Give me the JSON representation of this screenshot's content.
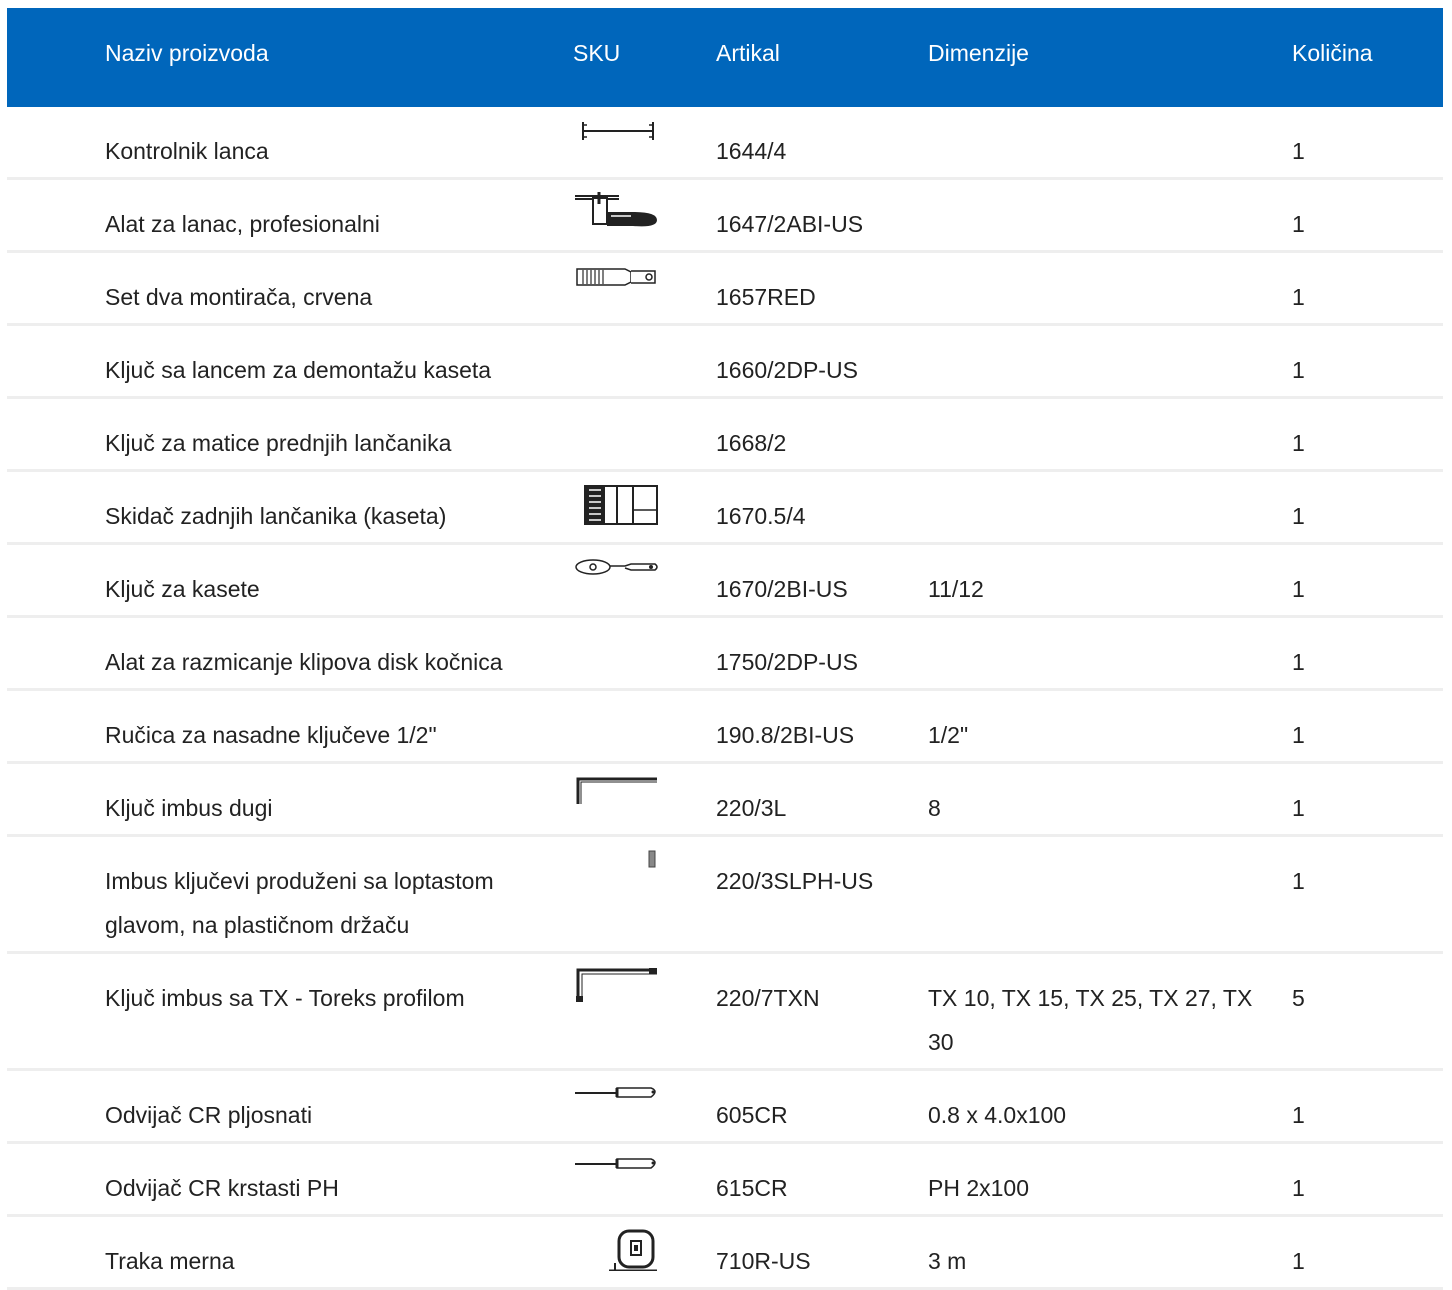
{
  "header": {
    "name": "Naziv proizvoda",
    "sku": "SKU",
    "artikal": "Artikal",
    "dimenzije": "Dimenzije",
    "kolicina": "Količina"
  },
  "rows": [
    {
      "name": "Kontrolnik lanca",
      "artikal": "1644/4",
      "dimenzije": "",
      "kolicina": "1",
      "icon": "chain-checker-icon"
    },
    {
      "name": "Alat za lanac, profesionalni",
      "artikal": "1647/2ABI-US",
      "dimenzije": "",
      "kolicina": "1",
      "icon": "chain-tool-icon"
    },
    {
      "name": "Set dva montirača, crvena",
      "artikal": "1657RED",
      "dimenzije": "",
      "kolicina": "1",
      "icon": "tyre-lever-icon"
    },
    {
      "name": "Ključ sa lancem za demontažu kaseta",
      "artikal": "1660/2DP-US",
      "dimenzije": "",
      "kolicina": "1",
      "icon": ""
    },
    {
      "name": "Ključ za matice prednjih lančanika",
      "artikal": "1668/2",
      "dimenzije": "",
      "kolicina": "1",
      "icon": ""
    },
    {
      "name": "Skidač zadnjih lančanika (kaseta)",
      "artikal": "1670.5/4",
      "dimenzije": "",
      "kolicina": "1",
      "icon": "cassette-remover-icon"
    },
    {
      "name": "Ključ za kasete",
      "artikal": "1670/2BI-US",
      "dimenzije": "11/12",
      "kolicina": "1",
      "icon": "cassette-wrench-icon"
    },
    {
      "name": "Alat za razmicanje klipova disk kočnica",
      "artikal": "1750/2DP-US",
      "dimenzije": "",
      "kolicina": "1",
      "icon": ""
    },
    {
      "name": "Ručica za nasadne ključeve 1/2\"",
      "artikal": "190.8/2BI-US",
      "dimenzije": "1/2\"",
      "kolicina": "1",
      "icon": ""
    },
    {
      "name": "Ključ imbus dugi",
      "artikal": "220/3L",
      "dimenzije": "8",
      "kolicina": "1",
      "icon": "hex-key-long-icon"
    },
    {
      "name": "Imbus ključevi produženi sa loptastom glavom, na plastičnom držaču",
      "artikal": "220/3SLPH-US",
      "dimenzije": "",
      "kolicina": "1",
      "icon": "hex-key-set-icon"
    },
    {
      "name": "Ključ imbus sa TX - Toreks profilom",
      "artikal": "220/7TXN",
      "dimenzije": "TX 10, TX 15, TX 25, TX 27, TX 30",
      "kolicina": "5",
      "icon": "torx-key-icon"
    },
    {
      "name": "Odvijač CR pljosnati",
      "artikal": "605CR",
      "dimenzije": "0.8 x 4.0x100",
      "kolicina": "1",
      "icon": "flat-screwdriver-icon"
    },
    {
      "name": "Odvijač CR krstasti PH",
      "artikal": "615CR",
      "dimenzije": "PH 2x100",
      "kolicina": "1",
      "icon": "phillips-screwdriver-icon"
    },
    {
      "name": "Traka merna",
      "artikal": "710R-US",
      "dimenzije": "3 m",
      "kolicina": "1",
      "icon": "tape-measure-icon"
    }
  ]
}
